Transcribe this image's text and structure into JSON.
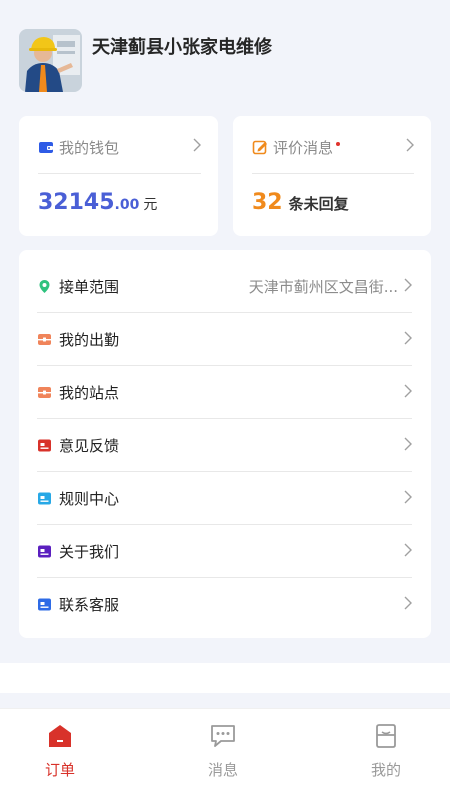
{
  "header": {
    "shop_name": "天津蓟县小张家电维修",
    "avatar": "technician-avatar"
  },
  "wallet_card": {
    "label": "我的钱包",
    "amount_integer": "32145",
    "amount_decimal": ".00",
    "unit": "元",
    "icon": "wallet-icon",
    "accent": "#4a5fd6"
  },
  "reviews_card": {
    "label": "评价消息",
    "count": "32",
    "suffix": "条未回复",
    "icon": "edit-icon",
    "accent": "#f08a1c",
    "unread_dot_color": "#e0322b"
  },
  "menu": [
    {
      "label": "接单范围",
      "value": "天津市蓟州区文昌街...",
      "icon": "location-pin-icon",
      "color": "#2ec27e"
    },
    {
      "label": "我的出勤",
      "value": "",
      "icon": "attendance-icon",
      "color": "#f0845a"
    },
    {
      "label": "我的站点",
      "value": "",
      "icon": "station-icon",
      "color": "#f0845a"
    },
    {
      "label": "意见反馈",
      "value": "",
      "icon": "feedback-icon",
      "color": "#d8322a"
    },
    {
      "label": "规则中心",
      "value": "",
      "icon": "rules-icon",
      "color": "#27a8e6"
    },
    {
      "label": "关于我们",
      "value": "",
      "icon": "about-icon",
      "color": "#5b1fbf"
    },
    {
      "label": "联系客服",
      "value": "",
      "icon": "customer-service-icon",
      "color": "#2e6be6"
    }
  ],
  "tabbar": {
    "tabs": [
      {
        "label": "订单",
        "icon": "order-house-icon",
        "active": true
      },
      {
        "label": "消息",
        "icon": "message-bubble-icon",
        "active": false
      },
      {
        "label": "我的",
        "icon": "profile-icon",
        "active": false
      }
    ],
    "active_color": "#d8322a",
    "inactive_color": "#9a9a9a"
  }
}
